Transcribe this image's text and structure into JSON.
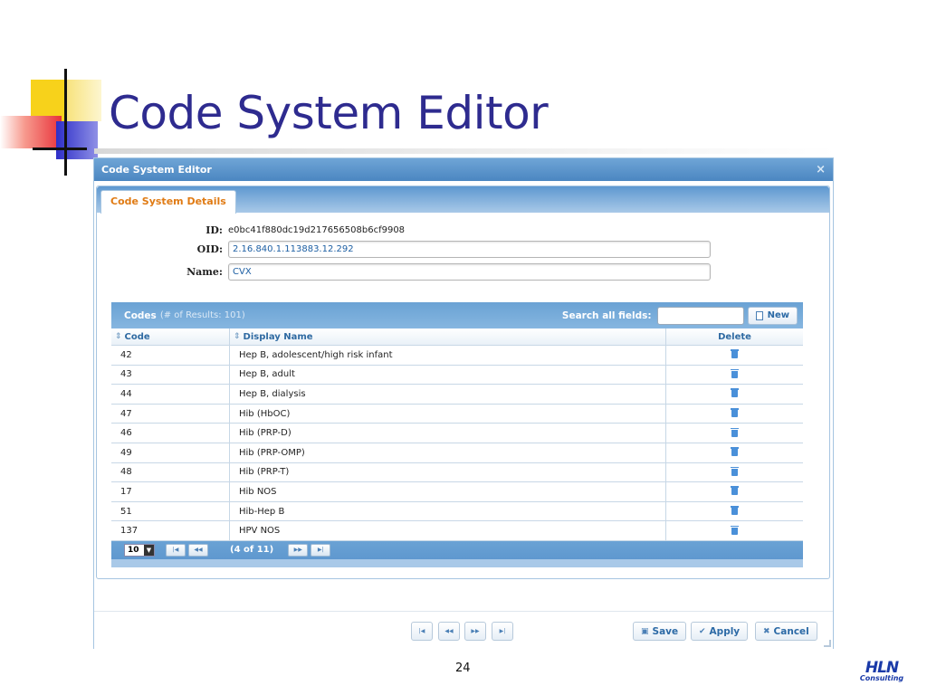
{
  "slide": {
    "title": "Code System Editor",
    "page_number": "24",
    "logo_top": "HLN",
    "logo_bottom": "Consulting"
  },
  "dialog": {
    "title": "Code System Editor",
    "close_icon": "×",
    "tab_label": "Code System Details",
    "fields": {
      "id_label": "ID:",
      "id_value": "e0bc41f880dc19d217656508b6cf9908",
      "oid_label": "OID:",
      "oid_value": "2.16.840.1.113883.12.292",
      "name_label": "Name:",
      "name_value": "CVX"
    }
  },
  "grid": {
    "title": "Codes",
    "subtitle": "(# of Results: 101)",
    "search_label": "Search all fields:",
    "search_value": "",
    "new_label": "New",
    "columns": [
      "Code",
      "Display Name",
      "Delete"
    ],
    "rows": [
      {
        "code": "42",
        "name": "Hep B, adolescent/high risk infant"
      },
      {
        "code": "43",
        "name": "Hep B, adult"
      },
      {
        "code": "44",
        "name": "Hep B, dialysis"
      },
      {
        "code": "47",
        "name": "Hib (HbOC)"
      },
      {
        "code": "46",
        "name": "Hib (PRP-D)"
      },
      {
        "code": "49",
        "name": "Hib (PRP-OMP)"
      },
      {
        "code": "48",
        "name": "Hib (PRP-T)"
      },
      {
        "code": "17",
        "name": "Hib NOS"
      },
      {
        "code": "51",
        "name": "Hib-Hep B"
      },
      {
        "code": "137",
        "name": "HPV NOS"
      }
    ],
    "pager": {
      "page_size": "10",
      "page_info": "(4 of 11)"
    }
  },
  "footer": {
    "save_label": "Save",
    "apply_label": "Apply",
    "cancel_label": "Cancel"
  },
  "colors": {
    "title": "#2e2b8f",
    "header_blue": "#4b86c1",
    "tab_orange": "#e07b14",
    "link_blue": "#2c6aa6"
  }
}
